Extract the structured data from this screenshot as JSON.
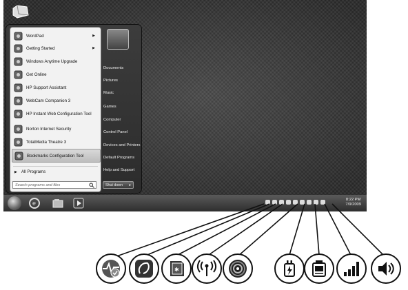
{
  "start_menu": {
    "programs": [
      {
        "label": "WordPad",
        "icon": "wordpad-icon",
        "has_arrow": true
      },
      {
        "label": "Getting Started",
        "icon": "getting-started-icon",
        "has_arrow": true
      },
      {
        "label": "Windows Anytime Upgrade",
        "icon": "windows-anytime-upgrade-icon",
        "has_arrow": false
      },
      {
        "label": "Get Online",
        "icon": "get-online-icon",
        "has_arrow": false
      },
      {
        "label": "HP Support Assistant",
        "icon": "hp-support-icon",
        "has_arrow": false
      },
      {
        "label": "WebCam Companion 3",
        "icon": "webcam-icon",
        "has_arrow": false
      },
      {
        "label": "HP Instant Web Configuration Tool",
        "icon": "hp-web-config-icon",
        "has_arrow": false
      },
      {
        "label": "Norton Internet Security",
        "icon": "norton-icon",
        "has_arrow": false
      },
      {
        "label": "TotalMedia Theatre 3",
        "icon": "totalmedia-icon",
        "has_arrow": false
      },
      {
        "label": "Bookmarks Configuration Tool",
        "icon": "bookmarks-tool-icon",
        "has_arrow": false,
        "selected": true
      }
    ],
    "all_programs": "All Programs",
    "search_placeholder": "Search programs and files",
    "right_links": [
      "Documents",
      "Pictures",
      "Music",
      "Games",
      "Computer",
      "Control Panel",
      "Devices and Printers",
      "Default Programs",
      "Help and Support"
    ],
    "shutdown_label": "Shut down"
  },
  "taskbar": {
    "pinned_icons": [
      "internet-explorer-icon",
      "windows-explorer-icon",
      "media-player-icon"
    ],
    "tray_icons": [
      "action-center-icon",
      "hp-recovery-icon",
      "bluetooth-icon",
      "wireless-icon",
      "disc-icon",
      "power-icon",
      "battery-icon",
      "network-icon",
      "volume-icon"
    ],
    "time": "8:22 PM",
    "date": "7/9/2009"
  },
  "callouts": [
    "action-center-icon",
    "hp-icon",
    "device-icon",
    "wireless-icon",
    "disc-icon",
    "power-icon",
    "battery-device-icon",
    "signal-strength-icon",
    "speaker-icon"
  ]
}
